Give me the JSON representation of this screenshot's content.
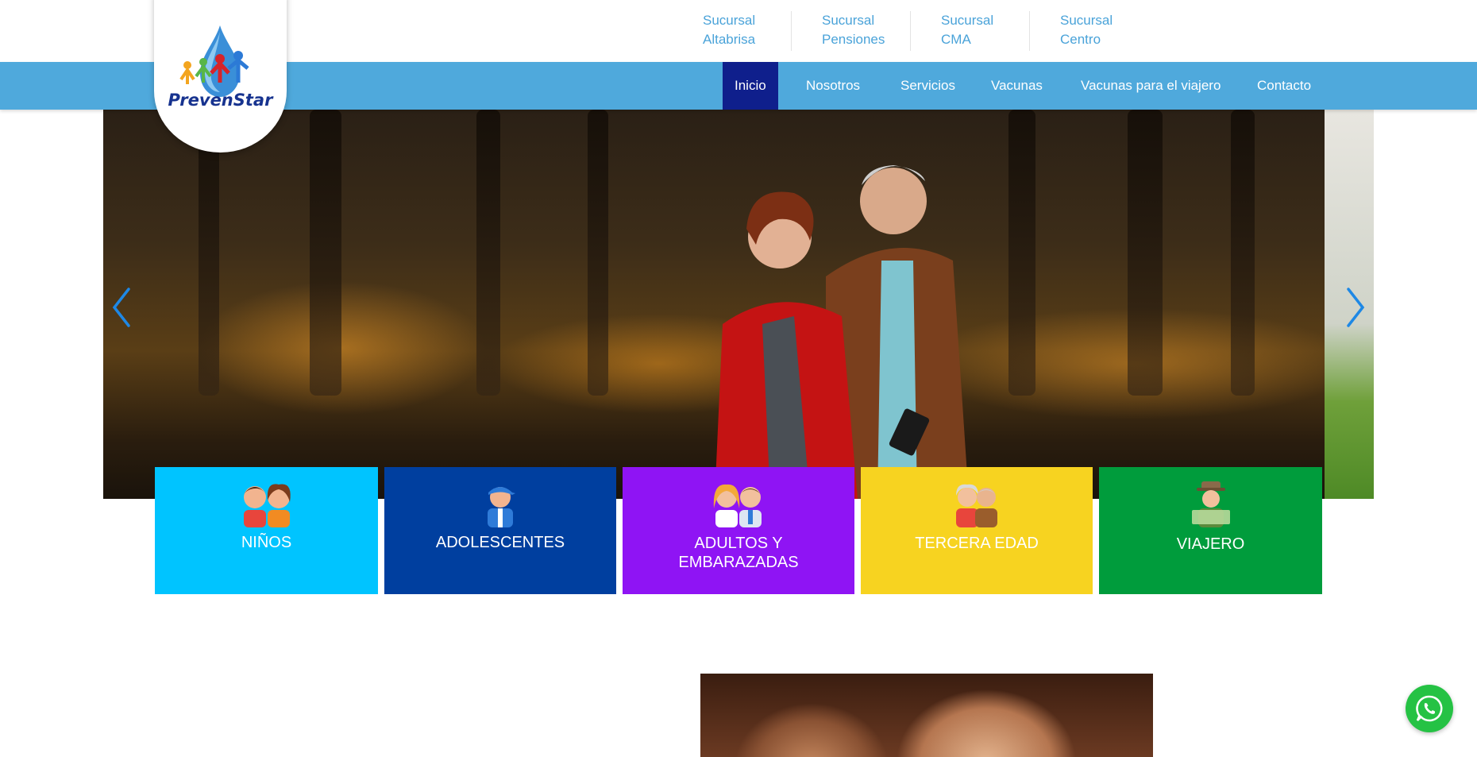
{
  "brand": {
    "name": "PrevenStar"
  },
  "branches": [
    {
      "line1": "Sucursal",
      "line2": "Altabrisa"
    },
    {
      "line1": "Sucursal",
      "line2": "Pensiones"
    },
    {
      "line1": "Sucursal",
      "line2": "CMA"
    },
    {
      "line1": "Sucursal",
      "line2": "Centro"
    }
  ],
  "nav": {
    "items": [
      {
        "label": "Inicio",
        "active": true
      },
      {
        "label": "Nosotros"
      },
      {
        "label": "Servicios"
      },
      {
        "label": "Vacunas"
      },
      {
        "label": "Vacunas para el viajero"
      },
      {
        "label": "Contacto"
      }
    ]
  },
  "categories": [
    {
      "label": "NIÑOS",
      "color": "#00c4ff",
      "icon": "children-icon"
    },
    {
      "label": "ADOLESCENTES",
      "color": "#003f9f",
      "icon": "teen-icon"
    },
    {
      "label": "ADULTOS Y",
      "label2": "EMBARAZADAS",
      "color": "#8f14f4",
      "icon": "adults-icon"
    },
    {
      "label": "TERCERA EDAD",
      "color": "#f7d320",
      "icon": "elderly-icon"
    },
    {
      "label": "VIAJERO",
      "color": "#009c3c",
      "icon": "traveler-icon"
    }
  ],
  "colors": {
    "primary_nav": "#4fa9dc",
    "active_nav": "#0f1f8c",
    "branch_text": "#4aa3d9",
    "whatsapp": "#25c244"
  }
}
